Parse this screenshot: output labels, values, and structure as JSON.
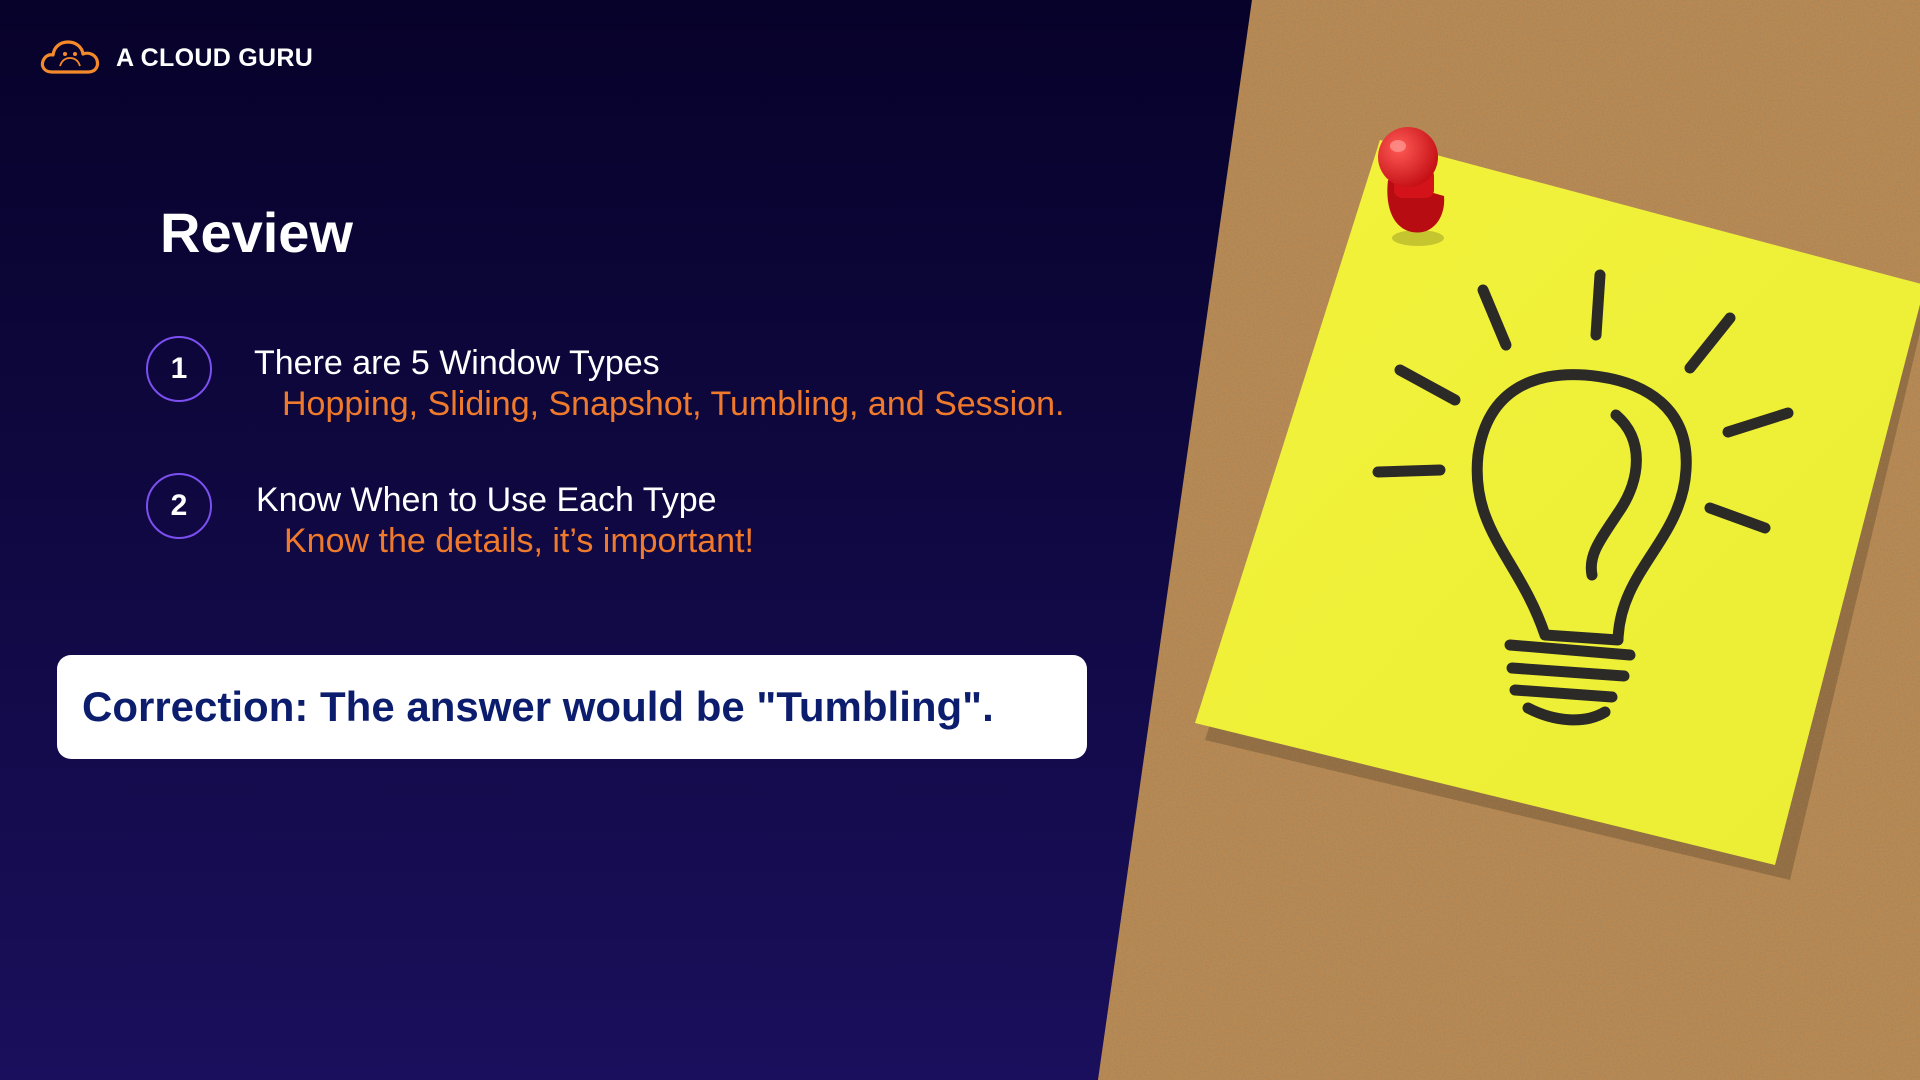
{
  "brand": {
    "name": "A CLOUD GURU",
    "logo_icon": "cloud-logo-icon",
    "accent": "#f58a2a"
  },
  "slide": {
    "title": "Review",
    "items": [
      {
        "number": "1",
        "heading": "There are 5 Window Types",
        "sub": "Hopping, Sliding, Snapshot, Tumbling, and Session."
      },
      {
        "number": "2",
        "heading": "Know When to Use Each Type",
        "sub": "Know the details, it’s important!"
      }
    ]
  },
  "correction": {
    "text": "Correction: The answer would be \"Tumbling\"."
  },
  "image": {
    "subject": "lightbulb-sticky-note-on-corkboard",
    "note_color": "#f1f33a",
    "pin_color": "#e0161e",
    "cork_color": "#c08a4e"
  },
  "colors": {
    "background": "#0d0630",
    "accent_orange": "#f07a2c",
    "badge_border": "#7b4ff0",
    "correction_text": "#0c1d6e"
  }
}
